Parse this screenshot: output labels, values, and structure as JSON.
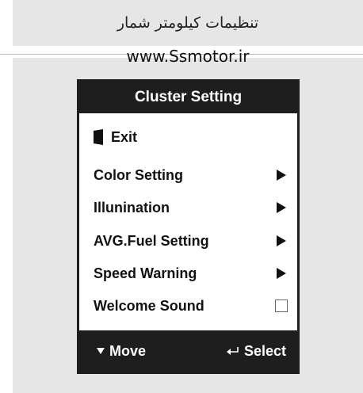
{
  "header": {
    "title": "تنظیمات کیلومتر شمار"
  },
  "url": "www.Ssmotor.ir",
  "menu": {
    "title": "Cluster Setting",
    "exit_label": "Exit",
    "items": [
      {
        "label": "Color Setting",
        "icon": "arrow-right-icon"
      },
      {
        "label": "Illunination",
        "icon": "arrow-right-icon"
      },
      {
        "label": "AVG.Fuel Setting",
        "icon": "arrow-right-icon"
      },
      {
        "label": "Speed Warning",
        "icon": "arrow-right-icon"
      },
      {
        "label": "Welcome Sound",
        "icon": "checkbox",
        "checked": false
      }
    ],
    "footer": {
      "move_label": "Move",
      "select_label": "Select"
    }
  },
  "colors": {
    "dark": "#1e1e1e",
    "panel": "#e6e6e6",
    "text": "#111111"
  }
}
